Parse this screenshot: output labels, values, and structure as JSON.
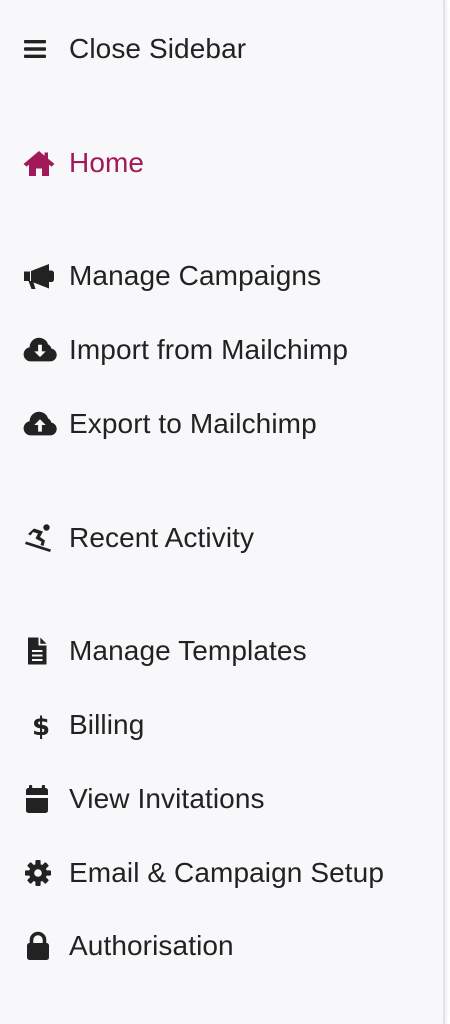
{
  "colors": {
    "background": "#f8f8fa",
    "text": "#222222",
    "active": "#a2195a"
  },
  "sidebar": {
    "close": {
      "label": "Close Sidebar",
      "icon": "bars-icon"
    },
    "items": [
      {
        "label": "Home",
        "icon": "home-icon",
        "active": true
      },
      {
        "label": "Manage Campaigns",
        "icon": "megaphone-icon"
      },
      {
        "label": "Import from Mailchimp",
        "icon": "cloud-download-icon"
      },
      {
        "label": "Export to Mailchimp",
        "icon": "cloud-upload-icon"
      },
      {
        "label": "Recent Activity",
        "icon": "snowboarding-icon"
      },
      {
        "label": "Manage Templates",
        "icon": "file-icon"
      },
      {
        "label": "Billing",
        "icon": "dollar-icon"
      },
      {
        "label": "View Invitations",
        "icon": "calendar-icon"
      },
      {
        "label": "Email & Campaign Setup",
        "icon": "gear-icon"
      },
      {
        "label": "Authorisation",
        "icon": "lock-icon"
      }
    ]
  }
}
